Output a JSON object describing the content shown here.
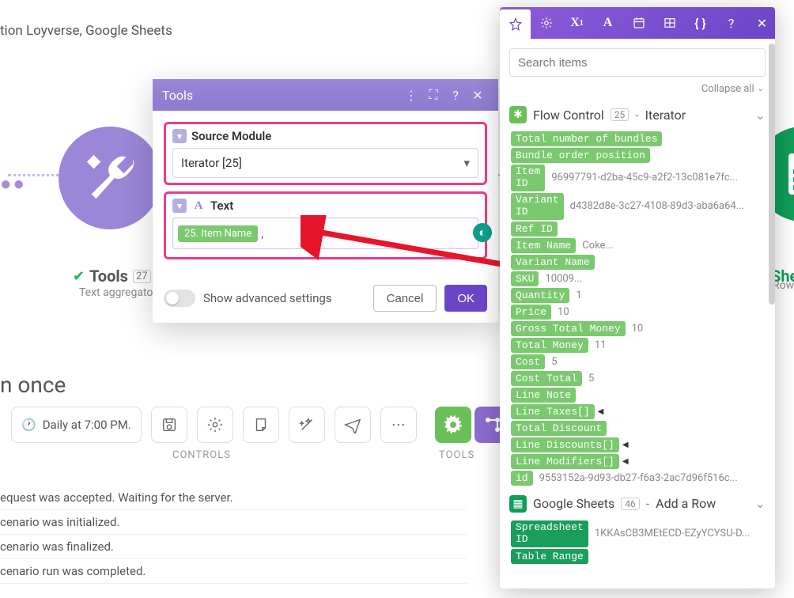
{
  "header": {
    "crumb_tail": "tion Loyverse, Google Sheets"
  },
  "canvas": {
    "tools_label": "Tools",
    "tools_badge": "27",
    "tools_sub": "Text aggregator",
    "gs_sub": "Row",
    "gs_label_top": "Shee"
  },
  "run_once_tail": "n once",
  "schedule_btn": "Daily at 7:00 PM.",
  "controls_label": "CONTROLS",
  "tools_label2": "TOOLS",
  "log": [
    "equest was accepted. Waiting for the server.",
    "cenario was initialized.",
    "cenario was finalized.",
    "cenario run was completed."
  ],
  "dialog": {
    "title": "Tools",
    "source_module_label": "Source Module",
    "source_module_value": "Iterator [25]",
    "text_label": "Text",
    "token": "25. Item Name",
    "trailing": ",",
    "advanced": "Show advanced settings",
    "cancel": "Cancel",
    "ok": "OK"
  },
  "panel": {
    "search_placeholder": "Search items",
    "collapse": "Collapse all",
    "group1": {
      "title": "Flow Control",
      "count": "25",
      "subtitle": "Iterator",
      "rows": [
        {
          "k": "Total number of bundles",
          "v": ""
        },
        {
          "k": "Bundle order position",
          "v": ""
        },
        {
          "k": "Item\nID",
          "v": "96997791-d2ba-45c9-a2f2-13c081e7fc..."
        },
        {
          "k": "Variant\nID",
          "v": "d4382d8e-3c27-4108-89d3-aba6a64..."
        },
        {
          "k": "Ref ID",
          "v": ""
        },
        {
          "k": "Item Name",
          "v": "Coke..."
        },
        {
          "k": "Variant Name",
          "v": ""
        },
        {
          "k": "SKU",
          "v": "10009..."
        },
        {
          "k": "Quantity",
          "v": "1"
        },
        {
          "k": "Price",
          "v": "10"
        },
        {
          "k": "Gross Total Money",
          "v": "10"
        },
        {
          "k": "Total Money",
          "v": "11"
        },
        {
          "k": "Cost",
          "v": "5"
        },
        {
          "k": "Cost Total",
          "v": "5"
        },
        {
          "k": "Line Note",
          "v": ""
        },
        {
          "k": "Line Taxes[]",
          "v": "",
          "arr": true
        },
        {
          "k": "Total Discount",
          "v": ""
        },
        {
          "k": "Line Discounts[]",
          "v": "",
          "arr": true
        },
        {
          "k": "Line Modifiers[]",
          "v": "",
          "arr": true
        },
        {
          "k": "id",
          "v": "9553152a-9d93-db27-f6a3-2ac7d96f516c..."
        }
      ]
    },
    "group2": {
      "title": "Google Sheets",
      "count": "46",
      "subtitle": "Add a Row",
      "rows": [
        {
          "k": "Spreadsheet\nID",
          "v": "1KKAsCB3MEtECD-EZyYCYSU-D..."
        },
        {
          "k": "Table Range",
          "v": ""
        }
      ]
    }
  }
}
